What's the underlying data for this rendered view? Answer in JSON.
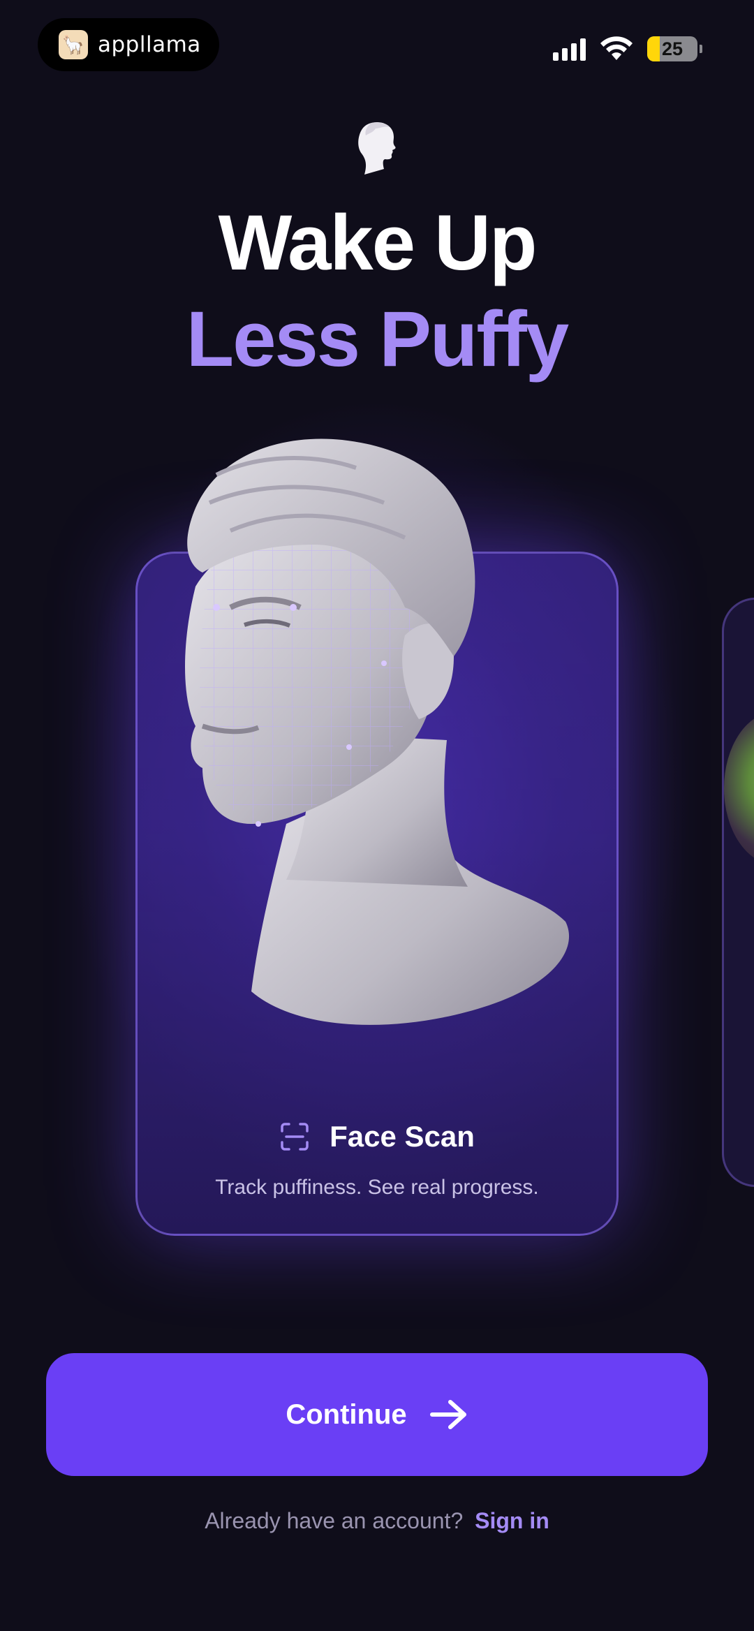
{
  "status_bar": {
    "brand_name": "appllama",
    "battery_percent": "25",
    "battery_level": 0.25,
    "signal_bars": 4,
    "battery_color": "#ffd60a"
  },
  "header": {
    "icon": "head-profile-icon",
    "title_line1": "Wake Up",
    "title_line2": "Less Puffy",
    "accent_color": "#a48bf5"
  },
  "carousel": {
    "cards": [
      {
        "image": "face-scan-bust",
        "icon": "face-scan-icon",
        "title": "Face Scan",
        "subtitle": "Track puffiness. See real progress."
      },
      {
        "image": "salad-bowl"
      }
    ]
  },
  "actions": {
    "continue_label": "Continue",
    "continue_icon": "arrow-right-icon",
    "button_color": "#6a3ff5",
    "signin_prompt": "Already have an account?",
    "signin_link": "Sign in"
  }
}
